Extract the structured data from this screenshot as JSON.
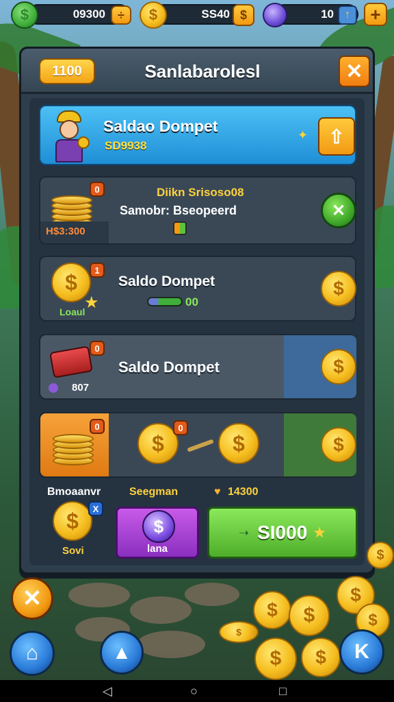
{
  "topbar": {
    "currency1_value": "09300",
    "currency1_button": "÷",
    "currency2_value": "SS40",
    "currency3_value": "10"
  },
  "panel": {
    "level_badge": "1100",
    "title": "Sanlabarolesl"
  },
  "hero_row": {
    "title": "Saldao Dompet",
    "amount": "SD9938"
  },
  "row1": {
    "price": "H$3:300",
    "line1": "Diikn Srisoso08",
    "line2": "Samobr: Bseopeerd",
    "tag": "0"
  },
  "row2": {
    "label": "Loaul",
    "title": "Saldo Dompet",
    "amount": "00",
    "tag": "1"
  },
  "row3": {
    "amount": "807",
    "title": "Saldo Dompet",
    "tag": "0"
  },
  "row4": {
    "tag1": "0",
    "tag2": "0"
  },
  "labels": {
    "left": "Bmoaanvr",
    "middle": "Seegman",
    "right_value": "14300",
    "coin_label": "Sovi",
    "coin_tag": "X",
    "gem_label": "lana",
    "buy_button": "SI000"
  },
  "colors": {
    "hero_bg": "#2fa7e8",
    "buy_bg": "#6fcb2a",
    "gem_bg": "#a63ed8",
    "accent_orange": "#f29a12"
  }
}
